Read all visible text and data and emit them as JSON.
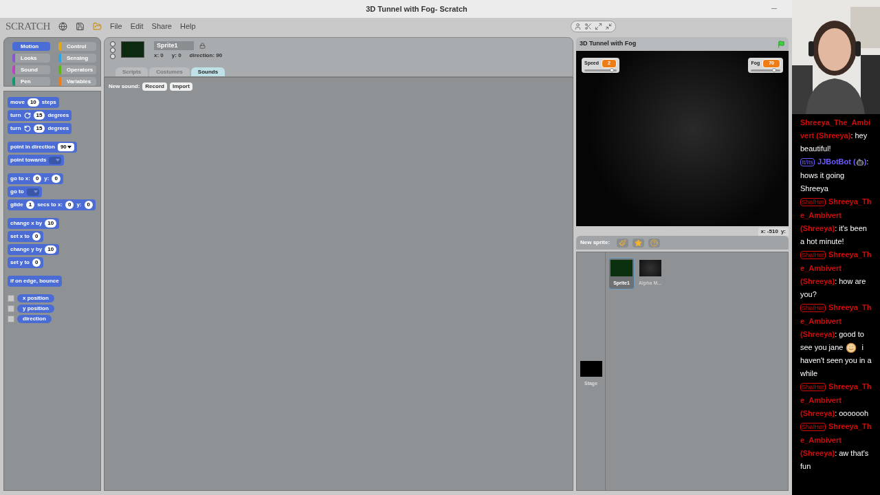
{
  "window": {
    "title": "3D Tunnel with Fog- Scratch"
  },
  "menu": {
    "logo": "SCRATCH",
    "items": [
      "File",
      "Edit",
      "Share",
      "Help"
    ]
  },
  "categories": [
    {
      "label": "Motion",
      "color": "#4a6cd4",
      "selected": true
    },
    {
      "label": "Control",
      "color": "#e1a91a",
      "selected": false
    },
    {
      "label": "Looks",
      "color": "#8a55d7",
      "selected": false
    },
    {
      "label": "Sensing",
      "color": "#2ca5e2",
      "selected": false
    },
    {
      "label": "Sound",
      "color": "#bb42c3",
      "selected": false
    },
    {
      "label": "Operators",
      "color": "#5cb712",
      "selected": false
    },
    {
      "label": "Pen",
      "color": "#0e9a6c",
      "selected": false
    },
    {
      "label": "Variables",
      "color": "#ee7d16",
      "selected": false
    }
  ],
  "block_groups": [
    {
      "blocks": [
        {
          "kind": "block",
          "parts": [
            {
              "kind": "text",
              "t": "move"
            },
            {
              "kind": "number",
              "t": "10"
            },
            {
              "kind": "text",
              "t": "steps"
            }
          ]
        },
        {
          "kind": "block",
          "parts": [
            {
              "kind": "text",
              "t": "turn"
            },
            {
              "kind": "rotate_cw"
            },
            {
              "kind": "number",
              "t": "15"
            },
            {
              "kind": "text",
              "t": "degrees"
            }
          ]
        },
        {
          "kind": "block",
          "parts": [
            {
              "kind": "text",
              "t": "turn"
            },
            {
              "kind": "rotate_ccw"
            },
            {
              "kind": "number",
              "t": "15"
            },
            {
              "kind": "text",
              "t": "degrees"
            }
          ]
        }
      ]
    },
    {
      "blocks": [
        {
          "kind": "block",
          "parts": [
            {
              "kind": "text",
              "t": "point in direction"
            },
            {
              "kind": "menu_number",
              "t": "90"
            }
          ]
        },
        {
          "kind": "block",
          "parts": [
            {
              "kind": "text",
              "t": "point towards"
            },
            {
              "kind": "menu"
            }
          ]
        }
      ]
    },
    {
      "blocks": [
        {
          "kind": "block",
          "parts": [
            {
              "kind": "text",
              "t": "go to x:"
            },
            {
              "kind": "number",
              "t": "0"
            },
            {
              "kind": "text",
              "t": "y:"
            },
            {
              "kind": "number",
              "t": "0"
            }
          ]
        },
        {
          "kind": "block",
          "parts": [
            {
              "kind": "text",
              "t": "go to"
            },
            {
              "kind": "menu"
            }
          ]
        },
        {
          "kind": "block",
          "parts": [
            {
              "kind": "text",
              "t": "glide"
            },
            {
              "kind": "number",
              "t": "1"
            },
            {
              "kind": "text",
              "t": "secs to x:"
            },
            {
              "kind": "number",
              "t": "0"
            },
            {
              "kind": "text",
              "t": "y:"
            },
            {
              "kind": "number",
              "t": "0"
            }
          ]
        }
      ]
    },
    {
      "blocks": [
        {
          "kind": "block",
          "parts": [
            {
              "kind": "text",
              "t": "change x by"
            },
            {
              "kind": "number",
              "t": "10"
            }
          ]
        },
        {
          "kind": "block",
          "parts": [
            {
              "kind": "text",
              "t": "set x to"
            },
            {
              "kind": "number",
              "t": "0"
            }
          ]
        },
        {
          "kind": "block",
          "parts": [
            {
              "kind": "text",
              "t": "change y by"
            },
            {
              "kind": "number",
              "t": "10"
            }
          ]
        },
        {
          "kind": "block",
          "parts": [
            {
              "kind": "text",
              "t": "set y to"
            },
            {
              "kind": "number",
              "t": "0"
            }
          ]
        }
      ]
    },
    {
      "blocks": [
        {
          "kind": "block",
          "parts": [
            {
              "kind": "text",
              "t": "if on edge, bounce"
            }
          ]
        }
      ]
    },
    {
      "blocks": [
        {
          "kind": "reporter",
          "checked": false,
          "parts": [
            {
              "kind": "text",
              "t": "x position"
            }
          ]
        },
        {
          "kind": "reporter",
          "checked": false,
          "parts": [
            {
              "kind": "text",
              "t": "y position"
            }
          ]
        },
        {
          "kind": "reporter",
          "checked": false,
          "parts": [
            {
              "kind": "text",
              "t": "direction"
            }
          ]
        }
      ]
    }
  ],
  "sprite": {
    "name": "Sprite1",
    "x": "x: 0",
    "y": "y: 0",
    "direction": "direction: 90"
  },
  "tabs": [
    {
      "label": "Scripts",
      "selected": false
    },
    {
      "label": "Costumes",
      "selected": false
    },
    {
      "label": "Sounds",
      "selected": true
    }
  ],
  "sounds": {
    "label": "New sound:",
    "buttons": [
      "Record",
      "Import"
    ]
  },
  "stage": {
    "title": "3D Tunnel with Fog",
    "monitors": [
      {
        "label": "Speed",
        "value": "2",
        "level": 0.85
      },
      {
        "label": "Fog",
        "value": "70",
        "level": 0.8
      }
    ],
    "x_readout": "x: -510",
    "y_readout": "y:"
  },
  "sprite_pane": {
    "label": "New sprite:",
    "sprites": [
      {
        "name": "Sprite1",
        "selected": true
      },
      {
        "name": "Alpha M...",
        "selected": false
      }
    ],
    "stage_label": "Stage"
  },
  "chat": [
    {
      "kind": "plain",
      "color": "#d10a0a",
      "name": "Shreeya_The_Ambivert (Shreeya)",
      "text": ": hey beautiful!"
    },
    {
      "kind": "name_icon",
      "color": "#6a5cff",
      "badge": "It/Its",
      "name": "JJBotBot (",
      "name_end": ")",
      "text": ": hows it going Shreeya"
    },
    {
      "kind": "plain",
      "color": "#d10a0a",
      "badge": "She/Her",
      "name": "Shreeya_The_Ambivert (Shreeya)",
      "text": ": it's been a hot minute!"
    },
    {
      "kind": "plain",
      "color": "#d10a0a",
      "badge": "She/Her",
      "name": "Shreeya_The_Ambivert (Shreeya)",
      "text": ": how are you?"
    },
    {
      "kind": "text_icon",
      "color": "#d10a0a",
      "badge": "She/Her",
      "name": "Shreeya_The_Ambivert (Shreeya)",
      "text": ": good to see you jane",
      "text_end": "i haven't seen you in a while"
    },
    {
      "kind": "plain",
      "color": "#d10a0a",
      "badge": "She/Her",
      "name": "Shreeya_The_Ambivert (Shreeya)",
      "text": ": ooooooh"
    },
    {
      "kind": "plain",
      "color": "#d10a0a",
      "badge": "She/Her",
      "name": "Shreeya_The_Ambivert (Shreeya)",
      "text": ": aw that's fun"
    }
  ]
}
